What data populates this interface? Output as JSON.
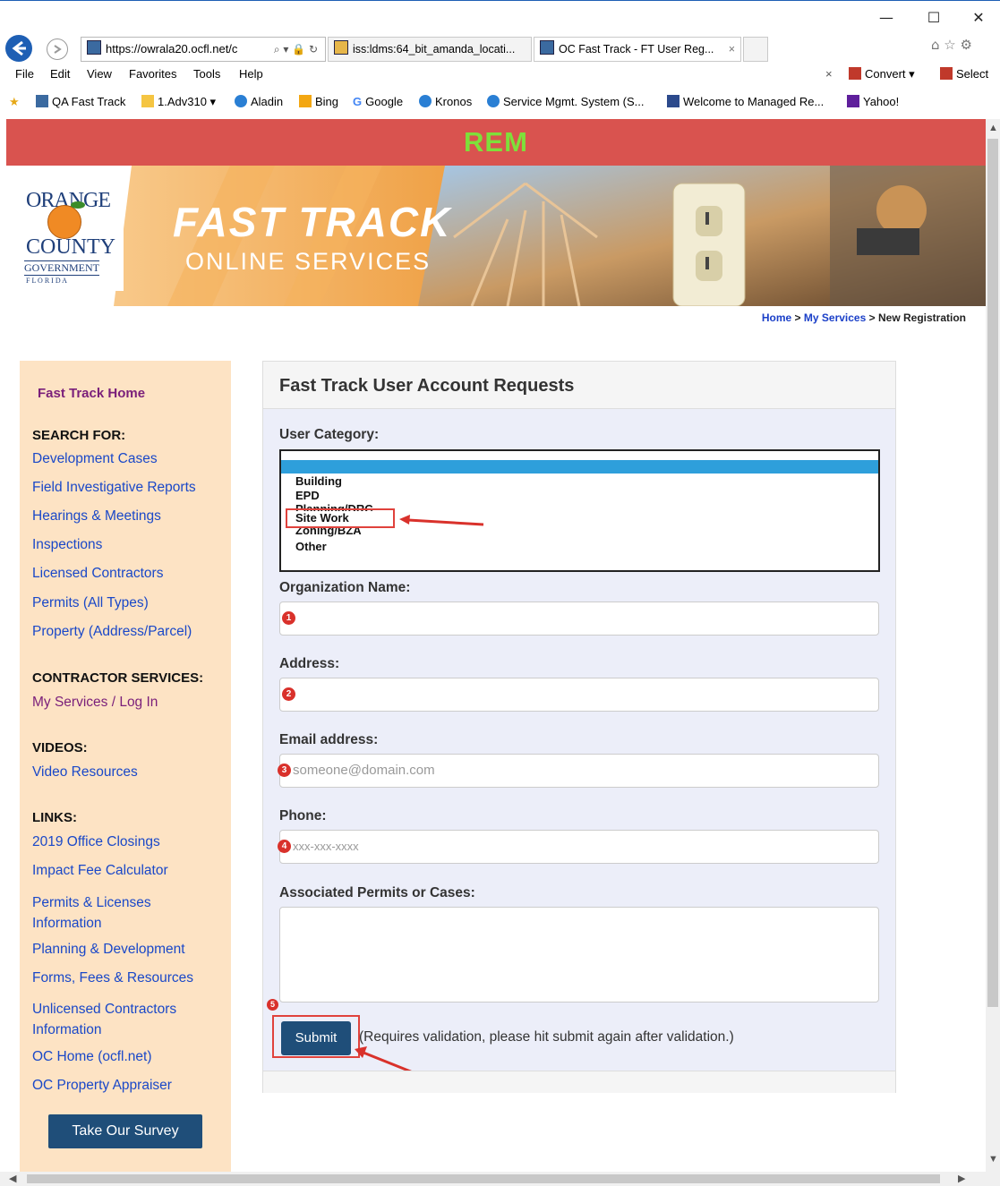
{
  "browser": {
    "url": "https://owrala20.ocfl.net/c",
    "tabs": [
      {
        "label": "iss:ldms:64_bit_amanda_locati..."
      },
      {
        "label": "OC Fast Track - FT User Reg..."
      }
    ],
    "menu": [
      "File",
      "Edit",
      "View",
      "Favorites",
      "Tools",
      "Help"
    ],
    "convert_label": "Convert",
    "select_label": "Select",
    "favorites": [
      "QA Fast Track",
      "1.Adv310",
      "Aladin",
      "Bing",
      "Google",
      "Kronos",
      "Service Mgmt. System (S...",
      "Welcome to Managed Re...",
      "Yahoo!"
    ]
  },
  "header": {
    "rem": "REM",
    "logo_line1": "ORANGE",
    "logo_line2": "COUNTY",
    "logo_line3": "GOVERNMENT",
    "logo_line4": "F L O R I D A",
    "banner_title": "FAST TRACK",
    "banner_sub": "ONLINE SERVICES"
  },
  "breadcrumb": {
    "home": "Home",
    "sep1": ">",
    "my_services": "My Services",
    "sep2": ">",
    "current": "New Registration"
  },
  "sidebar": {
    "home": "Fast Track Home",
    "search_heading": "SEARCH FOR:",
    "search_items": [
      "Development Cases",
      "Field Investigative Reports",
      "Hearings & Meetings",
      "Inspections",
      "Licensed Contractors",
      "Permits (All Types)",
      "Property (Address/Parcel)"
    ],
    "contractor_heading": "CONTRACTOR SERVICES:",
    "my_services": "My Services / Log In",
    "videos_heading": "VIDEOS:",
    "video_resources": "Video Resources",
    "links_heading": "LINKS:",
    "links": [
      "2019 Office Closings",
      "Impact Fee Calculator",
      "Permits & Licenses Information",
      "Planning & Development",
      "Forms, Fees & Resources",
      "Unlicensed Contractors Information",
      "OC Home (ocfl.net)",
      "OC Property Appraiser"
    ],
    "survey": "Take Our Survey"
  },
  "form": {
    "title": "Fast Track User Account Requests",
    "user_category_label": "User Category:",
    "categories": [
      "Building",
      "EPD",
      "Planning/DRC",
      "Site Work",
      "Zoning/BZA",
      "Other"
    ],
    "org_label": "Organization Name:",
    "address_label": "Address:",
    "email_label": "Email address:",
    "email_placeholder": "someone@domain.com",
    "phone_label": "Phone:",
    "phone_placeholder": "xxx-xxx-xxxx",
    "permits_label": "Associated Permits or Cases:",
    "submit": "Submit",
    "submit_note": "(Requires validation, please hit submit again after validation.)",
    "badges": [
      "1",
      "2",
      "3",
      "4",
      "5"
    ]
  }
}
